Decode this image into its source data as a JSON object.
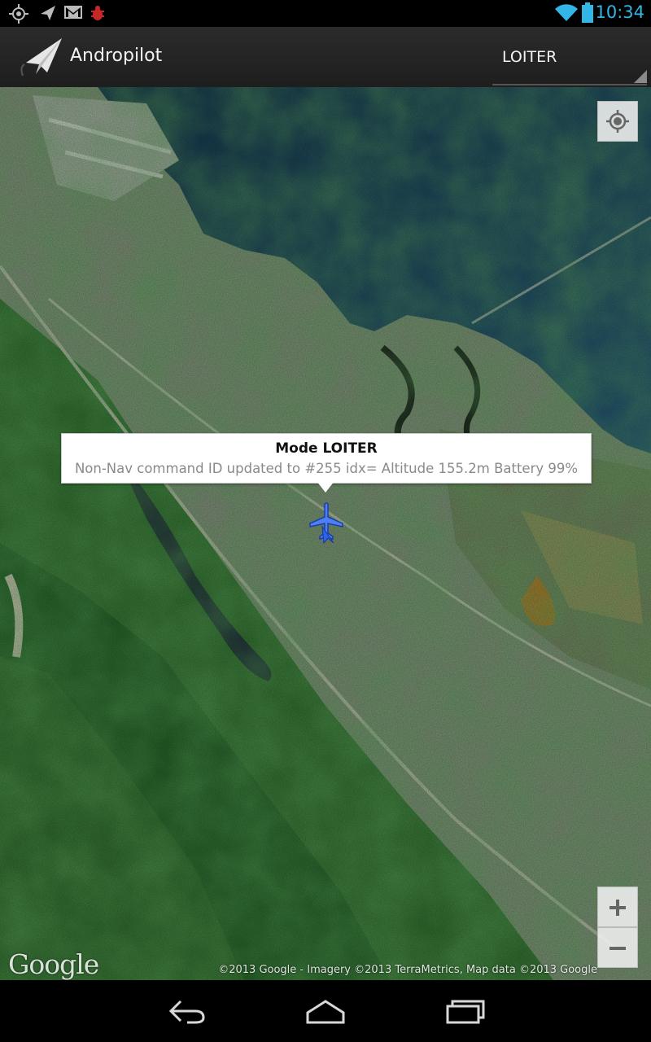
{
  "status_bar": {
    "time": "10:34",
    "left_icons": [
      "gps-icon",
      "send-icon",
      "gmail-icon",
      "debug-icon"
    ],
    "right_icons": [
      "wifi-icon",
      "battery-icon"
    ],
    "accent": "#33b5e5"
  },
  "action_bar": {
    "app_title": "Andropilot",
    "mode_selected": "LOITER"
  },
  "map": {
    "info_window": {
      "title": "Mode LOITER",
      "snippet": "Non-Nav command ID updated to #255 idx= Altitude 155.2m Battery 99%"
    },
    "marker_icon": "airplane-icon",
    "controls": {
      "my_location_icon": "my-location-icon",
      "zoom_in": "+",
      "zoom_out": "−"
    },
    "logo": "Google",
    "copyright": "©2013 Google - Imagery ©2013 TerraMetrics, Map data ©2013 Google"
  },
  "nav_bar": {
    "icons": [
      "back-icon",
      "home-icon",
      "recent-apps-icon"
    ]
  }
}
